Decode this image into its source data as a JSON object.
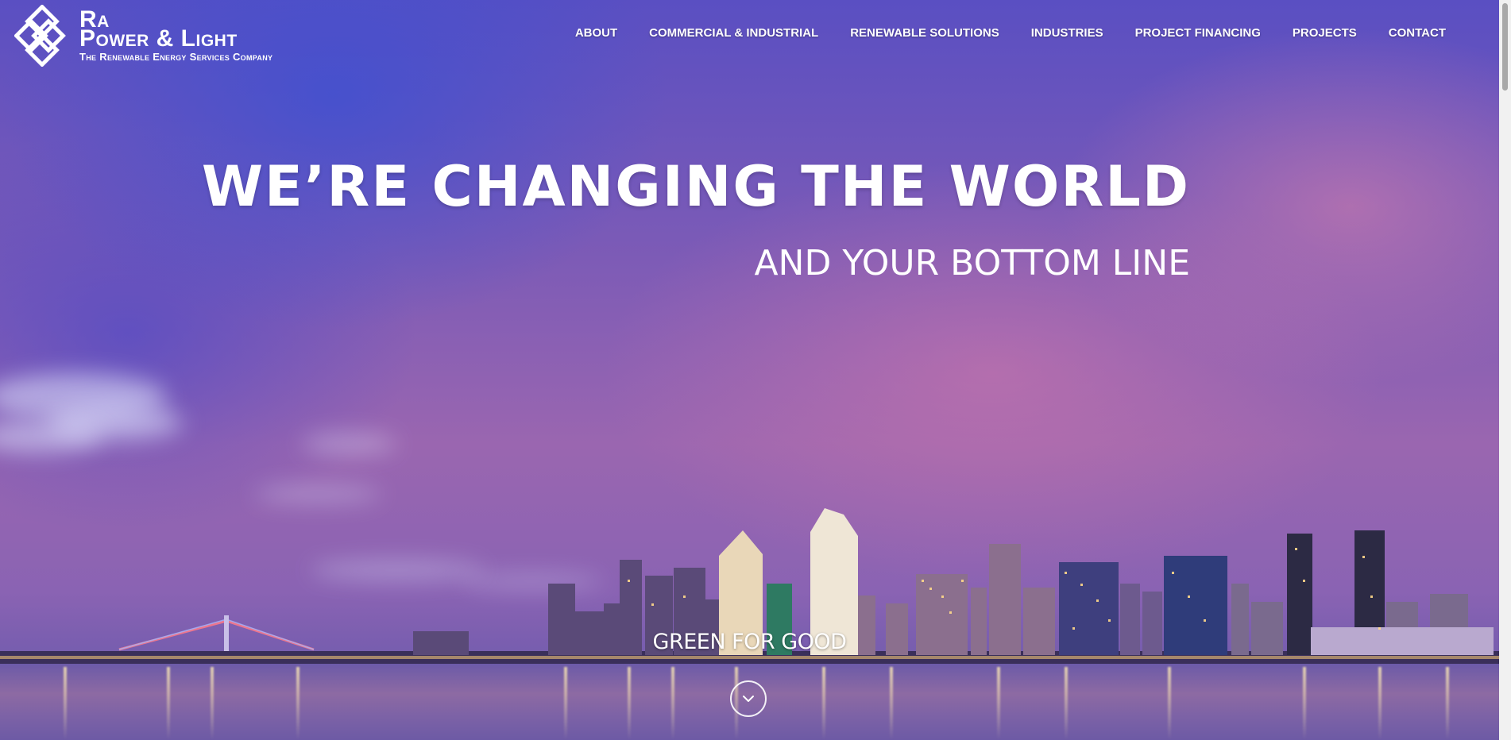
{
  "brand": {
    "name_line1": "Ra",
    "name_line2": "Power & Light",
    "tagline": "The Renewable Energy Services Company",
    "logo_icon": "diamond-knot-logo-icon"
  },
  "nav": {
    "items": [
      {
        "label": "ABOUT"
      },
      {
        "label": "COMMERCIAL & INDUSTRIAL"
      },
      {
        "label": "RENEWABLE SOLUTIONS"
      },
      {
        "label": "INDUSTRIES"
      },
      {
        "label": "PROJECT FINANCING"
      },
      {
        "label": "PROJECTS"
      },
      {
        "label": "CONTACT"
      }
    ]
  },
  "hero": {
    "title": "WE’RE CHANGING THE WORLD",
    "subtitle": "AND YOUR BOTTOM LINE",
    "tagline": "GREEN FOR GOOD",
    "scroll_icon": "chevron-down-icon"
  },
  "colors": {
    "sky_top": "#5a4fc2",
    "sky_pink": "#c97fb0",
    "text": "#ffffff"
  }
}
